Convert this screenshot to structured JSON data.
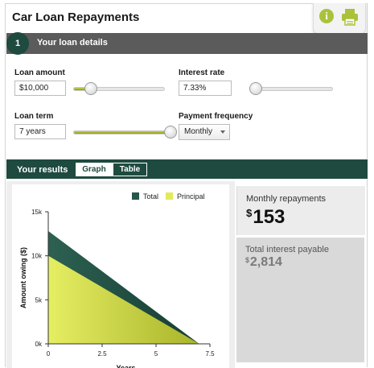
{
  "page_title": "Car Loan Repayments",
  "tools": {
    "info_icon": "info-icon",
    "print_icon": "print-icon",
    "info_glyph": "i"
  },
  "step": {
    "number": "1",
    "label": "Your loan details"
  },
  "fields": {
    "loan_amount": {
      "label": "Loan amount",
      "value": "$10,000",
      "slider_fraction": 0.18
    },
    "interest_rate": {
      "label": "Interest rate",
      "value": "7.33%",
      "slider_fraction": 0.07
    },
    "loan_term": {
      "label": "Loan term",
      "value": "7 years",
      "slider_fraction": 1.0
    },
    "payment_frequency": {
      "label": "Payment frequency",
      "selected": "Monthly"
    }
  },
  "results": {
    "label": "Your results",
    "tabs": [
      {
        "label": "Graph",
        "active": true
      },
      {
        "label": "Table",
        "active": false
      }
    ],
    "monthly_label": "Monthly repayments",
    "monthly_currency": "$",
    "monthly_value": "153",
    "total_label": "Total interest payable",
    "total_currency": "$",
    "total_value": "2,814"
  },
  "chart_data": {
    "type": "area",
    "xlabel": "Years",
    "ylabel": "Amount owing ($)",
    "xlim": [
      0,
      7.5
    ],
    "ylim": [
      0,
      15000
    ],
    "x_ticks": [
      "0",
      "2.5",
      "5",
      "7.5"
    ],
    "y_ticks": [
      "0k",
      "5k",
      "10k",
      "15k"
    ],
    "legend_position": "top-right",
    "series": [
      {
        "name": "Total",
        "color": "#27574a",
        "x": [
          0,
          7
        ],
        "y": [
          12814,
          0
        ]
      },
      {
        "name": "Principal",
        "color": "#e2ea5a",
        "x": [
          0,
          7
        ],
        "y": [
          10000,
          0
        ]
      }
    ]
  },
  "colors": {
    "accent": "#1e4a3f",
    "lime": "#a9c23a",
    "step_bar": "#5b5b5b"
  }
}
